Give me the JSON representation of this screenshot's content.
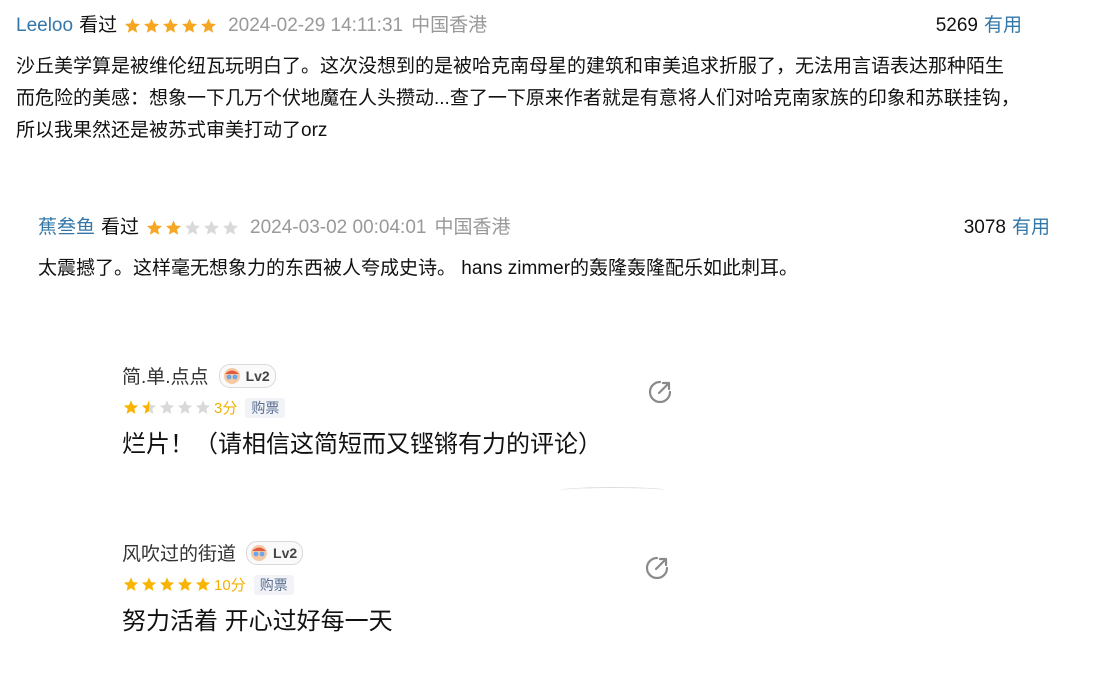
{
  "douban_comments": [
    {
      "user": "Leeloo",
      "status": "看过",
      "stars": 5,
      "time": "2024-02-29 14:11:31",
      "location": "中国香港",
      "votes": "5269",
      "useful_label": "有用",
      "text": "沙丘美学算是被维伦纽瓦玩明白了。这次没想到的是被哈克南母星的建筑和审美追求折服了，无法用言语表达那种陌生而危险的美感：想象一下几万个伏地魔在人头攒动...查了一下原来作者就是有意将人们对哈克南家族的印象和苏联挂钩，所以我果然还是被苏式审美打动了orz"
    },
    {
      "user": "蕉叁鱼",
      "status": "看过",
      "stars": 2,
      "time": "2024-03-02 00:04:01",
      "location": "中国香港",
      "votes": "3078",
      "useful_label": "有用",
      "text": "太震撼了。这样毫无想象力的东西被人夸成史诗。 hans zimmer的轰隆轰隆配乐如此刺耳。"
    }
  ],
  "maoyan_comments": [
    {
      "user": "简.单.点点",
      "level": "Lv2",
      "stars_filled": 1.5,
      "score": "3分",
      "buy_tag": "购票",
      "text": "烂片！（请相信这简短而又铿锵有力的评论）"
    },
    {
      "user": "风吹过的街道",
      "level": "Lv2",
      "stars_filled": 5,
      "score": "10分",
      "buy_tag": "购票",
      "text": "努力活着 开心过好每一天"
    }
  ],
  "colors": {
    "douban_star": "#f5a623",
    "maoyan_star": "#f8b400",
    "empty_star": "#d9d9d9",
    "link": "#3377aa"
  },
  "icons": [
    "star-icon",
    "level-face-icon",
    "share-icon"
  ]
}
